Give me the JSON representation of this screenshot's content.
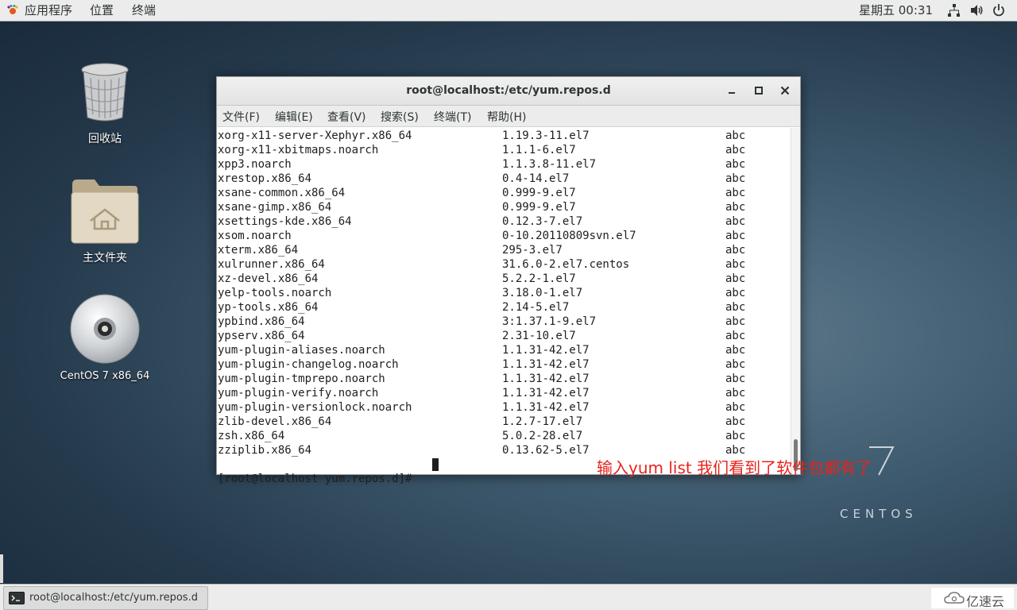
{
  "topbar": {
    "apps_label": "应用程序",
    "places_label": "位置",
    "terminal_label": "终端",
    "clock": "星期五 00:31",
    "tray_icons": [
      "network-icon",
      "volume-icon",
      "power-icon"
    ]
  },
  "desktop": {
    "icons": [
      {
        "label": "回收站",
        "icon": "trash-icon"
      },
      {
        "label": "主文件夹",
        "icon": "home-folder-icon"
      },
      {
        "label": "CentOS 7 x86_64",
        "icon": "dvd-icon"
      }
    ],
    "watermark_number": "7",
    "watermark_word": "CENTOS"
  },
  "window": {
    "title": "root@localhost:/etc/yum.repos.d",
    "menu": [
      "文件(F)",
      "编辑(E)",
      "查看(V)",
      "搜索(S)",
      "终端(T)",
      "帮助(H)"
    ],
    "rows": [
      {
        "pkg": "xorg-x11-server-Xephyr.x86_64",
        "ver": "1.19.3-11.el7",
        "repo": "abc"
      },
      {
        "pkg": "xorg-x11-xbitmaps.noarch",
        "ver": "1.1.1-6.el7",
        "repo": "abc"
      },
      {
        "pkg": "xpp3.noarch",
        "ver": "1.1.3.8-11.el7",
        "repo": "abc"
      },
      {
        "pkg": "xrestop.x86_64",
        "ver": "0.4-14.el7",
        "repo": "abc"
      },
      {
        "pkg": "xsane-common.x86_64",
        "ver": "0.999-9.el7",
        "repo": "abc"
      },
      {
        "pkg": "xsane-gimp.x86_64",
        "ver": "0.999-9.el7",
        "repo": "abc"
      },
      {
        "pkg": "xsettings-kde.x86_64",
        "ver": "0.12.3-7.el7",
        "repo": "abc"
      },
      {
        "pkg": "xsom.noarch",
        "ver": "0-10.20110809svn.el7",
        "repo": "abc"
      },
      {
        "pkg": "xterm.x86_64",
        "ver": "295-3.el7",
        "repo": "abc"
      },
      {
        "pkg": "xulrunner.x86_64",
        "ver": "31.6.0-2.el7.centos",
        "repo": "abc"
      },
      {
        "pkg": "xz-devel.x86_64",
        "ver": "5.2.2-1.el7",
        "repo": "abc"
      },
      {
        "pkg": "yelp-tools.noarch",
        "ver": "3.18.0-1.el7",
        "repo": "abc"
      },
      {
        "pkg": "yp-tools.x86_64",
        "ver": "2.14-5.el7",
        "repo": "abc"
      },
      {
        "pkg": "ypbind.x86_64",
        "ver": "3:1.37.1-9.el7",
        "repo": "abc"
      },
      {
        "pkg": "ypserv.x86_64",
        "ver": "2.31-10.el7",
        "repo": "abc"
      },
      {
        "pkg": "yum-plugin-aliases.noarch",
        "ver": "1.1.31-42.el7",
        "repo": "abc"
      },
      {
        "pkg": "yum-plugin-changelog.noarch",
        "ver": "1.1.31-42.el7",
        "repo": "abc"
      },
      {
        "pkg": "yum-plugin-tmprepo.noarch",
        "ver": "1.1.31-42.el7",
        "repo": "abc"
      },
      {
        "pkg": "yum-plugin-verify.noarch",
        "ver": "1.1.31-42.el7",
        "repo": "abc"
      },
      {
        "pkg": "yum-plugin-versionlock.noarch",
        "ver": "1.1.31-42.el7",
        "repo": "abc"
      },
      {
        "pkg": "zlib-devel.x86_64",
        "ver": "1.2.7-17.el7",
        "repo": "abc"
      },
      {
        "pkg": "zsh.x86_64",
        "ver": "5.0.2-28.el7",
        "repo": "abc"
      },
      {
        "pkg": "zziplib.x86_64",
        "ver": "0.13.62-5.el7",
        "repo": "abc"
      }
    ],
    "prompt": "[root@localhost yum.repos.d]# "
  },
  "annotation": "输入yum list 我们看到了软件包都有了",
  "taskbar": {
    "item_label": "root@localhost:/etc/yum.repos.d",
    "brand": "亿速云"
  }
}
